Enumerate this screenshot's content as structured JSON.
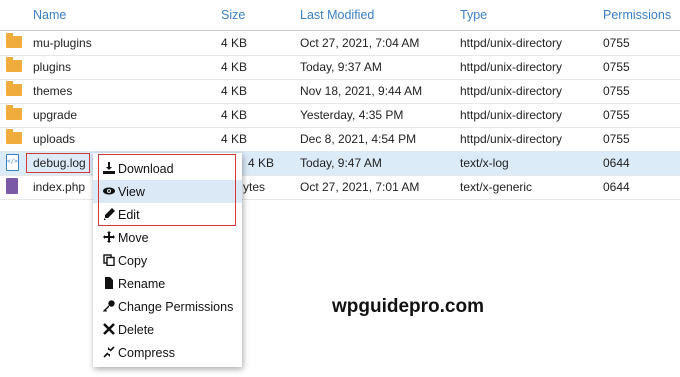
{
  "header": {
    "name": "Name",
    "size": "Size",
    "modified": "Last Modified",
    "type": "Type",
    "permissions": "Permissions"
  },
  "rows": [
    {
      "name": "mu-plugins",
      "size": "4 KB",
      "modified": "Oct 27, 2021, 7:04 AM",
      "type": "httpd/unix-directory",
      "perm": "0755",
      "icon": "folder-icon"
    },
    {
      "name": "plugins",
      "size": "4 KB",
      "modified": "Today, 9:37 AM",
      "type": "httpd/unix-directory",
      "perm": "0755",
      "icon": "folder-icon"
    },
    {
      "name": "themes",
      "size": "4 KB",
      "modified": "Nov 18, 2021, 9:44 AM",
      "type": "httpd/unix-directory",
      "perm": "0755",
      "icon": "folder-icon"
    },
    {
      "name": "upgrade",
      "size": "4 KB",
      "modified": "Yesterday, 4:35 PM",
      "type": "httpd/unix-directory",
      "perm": "0755",
      "icon": "folder-icon"
    },
    {
      "name": "uploads",
      "size": "4 KB",
      "modified": "Dec 8, 2021, 4:54 PM",
      "type": "httpd/unix-directory",
      "perm": "0755",
      "icon": "folder-icon"
    },
    {
      "name": "debug.log",
      "size": "4 KB",
      "modified": "Today, 9:47 AM",
      "type": "text/x-log",
      "perm": "0644",
      "icon": "code-file-icon"
    },
    {
      "name": "index.php",
      "size": "ytes",
      "modified": "Oct 27, 2021, 7:01 AM",
      "type": "text/x-generic",
      "perm": "0644",
      "icon": "php-file-icon"
    }
  ],
  "menu": [
    {
      "label": "Download",
      "icon": "download-icon"
    },
    {
      "label": "View",
      "icon": "eye-icon"
    },
    {
      "label": "Edit",
      "icon": "pencil-icon"
    },
    {
      "label": "Move",
      "icon": "move-arrows-icon"
    },
    {
      "label": "Copy",
      "icon": "copy-icon"
    },
    {
      "label": "Rename",
      "icon": "document-icon"
    },
    {
      "label": "Change Permissions",
      "icon": "key-icon"
    },
    {
      "label": "Delete",
      "icon": "x-icon"
    },
    {
      "label": "Compress",
      "icon": "compress-icon"
    }
  ],
  "watermark": "wpguidepro.com",
  "colors": {
    "header_link": "#3b7fc4",
    "selected_row": "#dcebf8",
    "highlight": "#d23a3a",
    "folder": "#f0ad3d"
  }
}
